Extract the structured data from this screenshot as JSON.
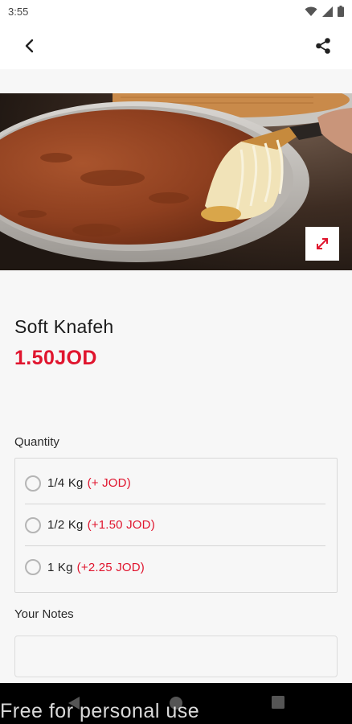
{
  "status_bar": {
    "time": "3:55"
  },
  "product": {
    "name": "Soft Knafeh",
    "price": "1.50JOD"
  },
  "quantity": {
    "label": "Quantity",
    "options": [
      {
        "label": "1/4 Kg",
        "price": "(+ JOD)"
      },
      {
        "label": "1/2 Kg",
        "price": "(+1.50 JOD)"
      },
      {
        "label": "1 Kg",
        "price": "(+2.25 JOD)"
      }
    ]
  },
  "notes": {
    "label": "Your Notes",
    "placeholder": ""
  },
  "watermark": "Free for personal use",
  "colors": {
    "accent": "#e0152e",
    "background": "#f7f7f7"
  },
  "icons": [
    "back-arrow-icon",
    "share-icon",
    "expand-icon",
    "wifi-icon",
    "signal-icon",
    "battery-icon",
    "nav-back-icon",
    "nav-home-icon",
    "nav-recents-icon"
  ]
}
